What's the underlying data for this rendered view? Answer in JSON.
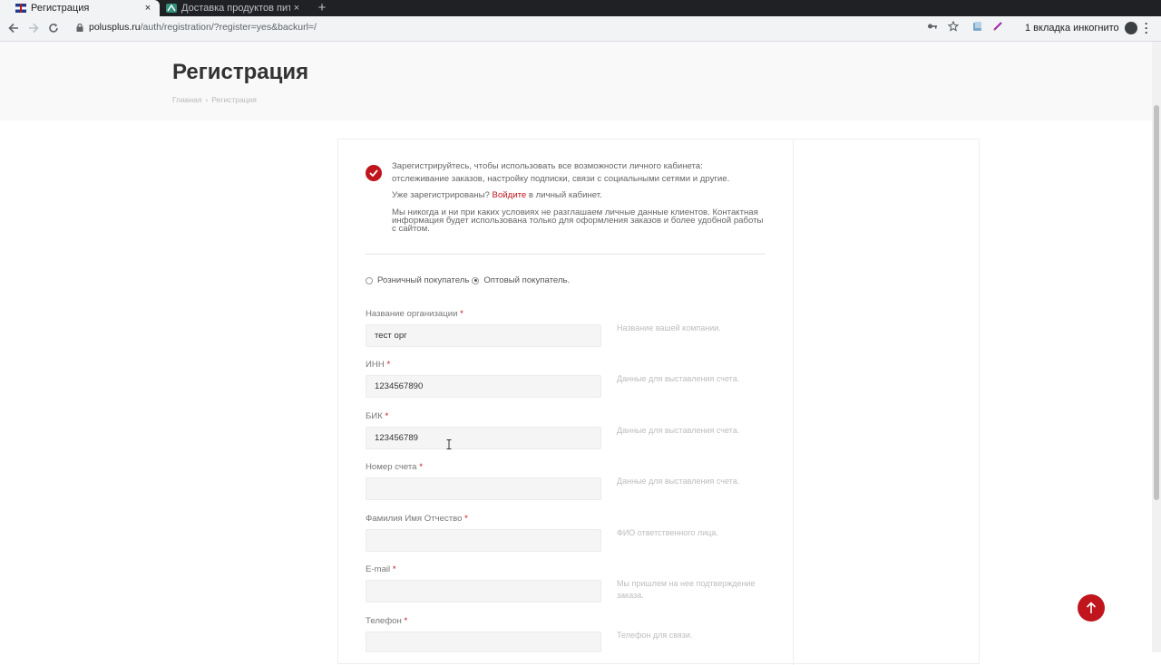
{
  "browser": {
    "tabs": [
      {
        "title": "Регистрация",
        "active": true
      },
      {
        "title": "Доставка продуктов пит",
        "active": false
      }
    ],
    "close_glyph": "×",
    "new_tab_glyph": "+",
    "url_host": "polusplus.ru",
    "url_path": "/auth/registration/?register=yes&backurl=/",
    "incognito_label": "1 вкладка инкогнито",
    "icons": [
      "back-icon",
      "forward-icon",
      "reload-icon",
      "lock-icon",
      "key-icon",
      "star-icon",
      "extension-icon",
      "pen-icon",
      "incognito-icon",
      "menu-icon"
    ]
  },
  "page": {
    "title": "Регистрация",
    "breadcrumb": {
      "home": "Главная",
      "sep": "›",
      "current": "Регистрация"
    }
  },
  "intro": {
    "line1": "Зарегистрируйтесь, чтобы использовать все возможности личного кабинета:",
    "line2": "отслеживание заказов, настройку подписки, связи с социальными сетями и другие.",
    "already": "Уже зарегистрированы?",
    "login_link": "Войдите",
    "already_tail": "в личный кабинет.",
    "privacy": "Мы никогда и ни при каких условиях не разглашаем личные данные клиентов. Контактная информация будет использована только для оформления заказов и более удобной работы с сайтом."
  },
  "buyer_type": {
    "retail": "Розничный покупатель",
    "wholesale": "Оптовый покупатель.",
    "selected": "wholesale"
  },
  "required_mark": "*",
  "fields": [
    {
      "label": "Название организации",
      "value": "тест орг",
      "hint": "Название вашей компании."
    },
    {
      "label": "ИНН",
      "value": "1234567890",
      "hint": "Данные для выставления счета."
    },
    {
      "label": "БИК",
      "value": "123456789",
      "hint": "Данные для выставления счета."
    },
    {
      "label": "Номер счета",
      "value": "",
      "hint": "Данные для выставления счета."
    },
    {
      "label": "Фамилия Имя Отчество",
      "value": "",
      "hint": "ФИО ответственного лица."
    },
    {
      "label": "E-mail",
      "value": "",
      "hint": "Мы пришлем на нее подтверждение заказа."
    },
    {
      "label": "Телефон",
      "value": "",
      "hint": "Телефон для связи."
    }
  ],
  "colors": {
    "accent": "#c0151d",
    "header_bg": "#f9f9f9",
    "input_bg": "#f5f5f5"
  }
}
